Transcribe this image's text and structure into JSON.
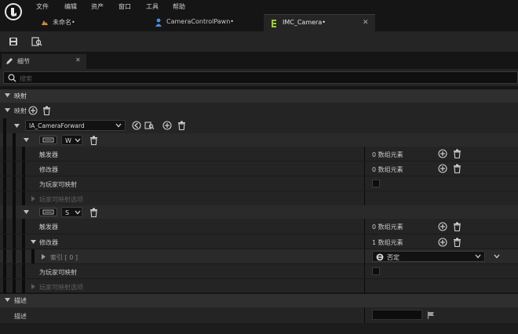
{
  "menubar": {
    "items": [
      "文件",
      "编辑",
      "资产",
      "窗口",
      "工具",
      "帮助"
    ]
  },
  "tabs": [
    {
      "label": "未命名•"
    },
    {
      "label": "CameraControlPawn•"
    },
    {
      "label": "IMC_Camera•"
    }
  ],
  "details_panel": {
    "tab_label": "细节",
    "search_placeholder": "搜索"
  },
  "sections": {
    "mappings_header": "映射",
    "mappings_label": "映射",
    "description_header": "描述",
    "description_label": "描述"
  },
  "mapping": {
    "action_name": "IA_CameraForward",
    "keys": [
      {
        "key": "W",
        "triggers_label": "触发器",
        "triggers_value": "0 数组元素",
        "modifiers_label": "修改器",
        "modifiers_value": "0 数组元素",
        "player_mappable_label": "为玩家可映射",
        "player_options_label": "玩家可映射选项"
      },
      {
        "key": "S",
        "triggers_label": "触发器",
        "triggers_value": "0 数组元素",
        "modifiers_label": "修改器",
        "modifiers_value": "1 数组元素",
        "index_label": "索引 [ 0 ]",
        "index_value": "否定",
        "player_mappable_label": "为玩家可映射",
        "player_options_label": "玩家可映射选项"
      }
    ]
  },
  "colors": {
    "background": "#151515",
    "panel_row": "#242424",
    "panel_row_alt": "#1f1f1f",
    "header": "#2f2f2f",
    "text": "#c9c9c9",
    "dim_text": "#6a6a6a",
    "accent_blue": "#4a8fd6"
  }
}
